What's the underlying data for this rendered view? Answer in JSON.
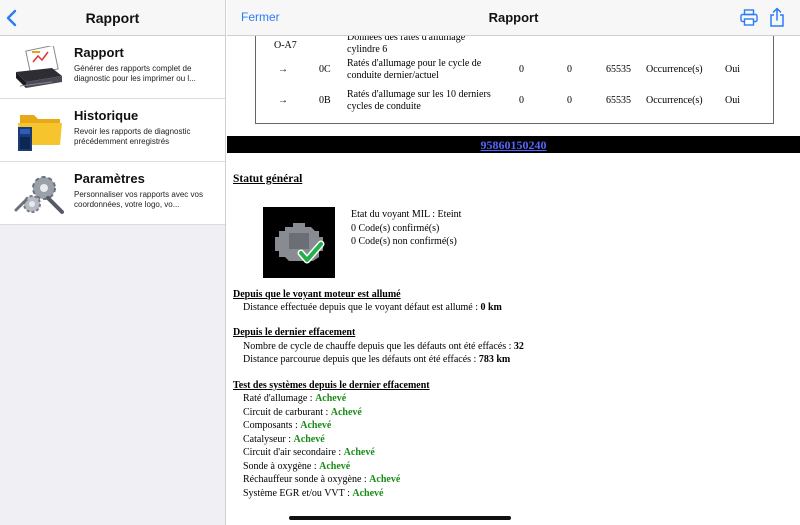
{
  "sidebar": {
    "title": "Rapport",
    "items": [
      {
        "label": "Rapport",
        "desc": "Générer des rapports complet de diagnostic pour les imprimer ou l...",
        "icon": "report-printer-icon"
      },
      {
        "label": "Historique",
        "desc": "Revoir les rapports de diagnostic précédemment enregistrés",
        "icon": "folder-sdcard-icon"
      },
      {
        "label": "Paramètres",
        "desc": "Personnaliser vos rapports avec vos coordonnées, votre logo, vo...",
        "icon": "gears-icon"
      }
    ]
  },
  "header": {
    "close_label": "Fermer",
    "title": "Rapport"
  },
  "codes": [
    {
      "arrow": "",
      "code": "",
      "first": "O-A7",
      "desc": "Données des ratés d'allumage cylindre 6",
      "v1": "",
      "v2": "",
      "v3": "",
      "unit": "",
      "yn": ""
    },
    {
      "arrow": "→",
      "code": "0C",
      "desc": "Ratés d'allumage pour le cycle de conduite dernier/actuel",
      "v1": "0",
      "v2": "0",
      "v3": "65535",
      "unit": "Occurrence(s)",
      "yn": "Oui"
    },
    {
      "arrow": "→",
      "code": "0B",
      "desc": "Ratés d'allumage sur les 10 derniers cycles de conduite",
      "v1": "0",
      "v2": "0",
      "v3": "65535",
      "unit": "Occurrence(s)",
      "yn": "Oui"
    }
  ],
  "vin": "95860150240",
  "status": {
    "title": "Statut général",
    "mil": "Etat du voyant MIL : Eteint",
    "confirmed": "0 Code(s) confirmé(s)",
    "unconfirmed": "0 Code(s) non confirmé(s)"
  },
  "since_mil": {
    "title": "Depuis que le voyant moteur est allumé",
    "distance_label": "Distance effectuée depuis que le voyant défaut est allumé : ",
    "distance_value": "0 km"
  },
  "since_clear": {
    "title": "Depuis le dernier effacement",
    "cycles_label": "Nombre de cycle de chauffe depuis que les défauts ont été effacés : ",
    "cycles_value": "32",
    "distance_label": "Distance parcourue depuis que les défauts ont été effacés : ",
    "distance_value": "783 km"
  },
  "tests": {
    "title": "Test des systèmes depuis le dernier effacement",
    "items": [
      {
        "label": "Raté d'allumage : ",
        "value": "Achevé"
      },
      {
        "label": "Circuit de carburant : ",
        "value": "Achevé"
      },
      {
        "label": "Composants : ",
        "value": "Achevé"
      },
      {
        "label": "Catalyseur : ",
        "value": "Achevé"
      },
      {
        "label": "Circuit d'air secondaire : ",
        "value": "Achevé"
      },
      {
        "label": "Sonde à oxygène : ",
        "value": "Achevé"
      },
      {
        "label": "Réchauffeur sonde à oxygène : ",
        "value": "Achevé"
      },
      {
        "label": "Système EGR et/ou VVT : ",
        "value": "Achevé"
      }
    ]
  },
  "colors": {
    "accent": "#2a7df6",
    "ok": "#1a8c1a",
    "vin_link": "#5566ff"
  }
}
